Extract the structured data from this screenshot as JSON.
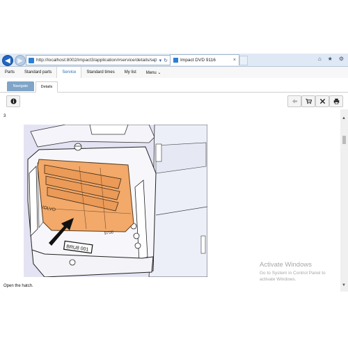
{
  "browser": {
    "url": "http://localhost:8002/impact3/application/#service/details/servic",
    "tab_title": "Impact DVD 9116",
    "tab_close": "×",
    "search_glyph": "ρ",
    "dropdown_glyph": "▾",
    "refresh_glyph": "↻",
    "tools": [
      "⌂",
      "★",
      "⚙"
    ]
  },
  "menubar": {
    "items": [
      "Parts",
      "Standard parts",
      "Service",
      "Standard times",
      "My list",
      "Menu ⌄"
    ],
    "active_index": 2
  },
  "subtabs": {
    "navigate": "Navigate",
    "details": "Details"
  },
  "toolbar": {
    "icons": [
      "info-icon",
      "back-arrow-icon",
      "cart-icon",
      "tools-icon",
      "print-icon"
    ]
  },
  "content": {
    "step_number": "3",
    "caption": "Open the hatch.",
    "figure": {
      "plate_text": "BRU8 001",
      "brand_text": "VOLVO",
      "model_text": "9700",
      "highlight_color": "#f2a969",
      "background_color": "#e3e3f3"
    }
  },
  "watermark": {
    "title": "Activate Windows",
    "line": "Go to System in Control Panel to activate Windows."
  },
  "colors": {
    "browser_bar": "#dfe9f5",
    "accent": "#2c6db5",
    "navigate_tab": "#7fa4c8"
  }
}
